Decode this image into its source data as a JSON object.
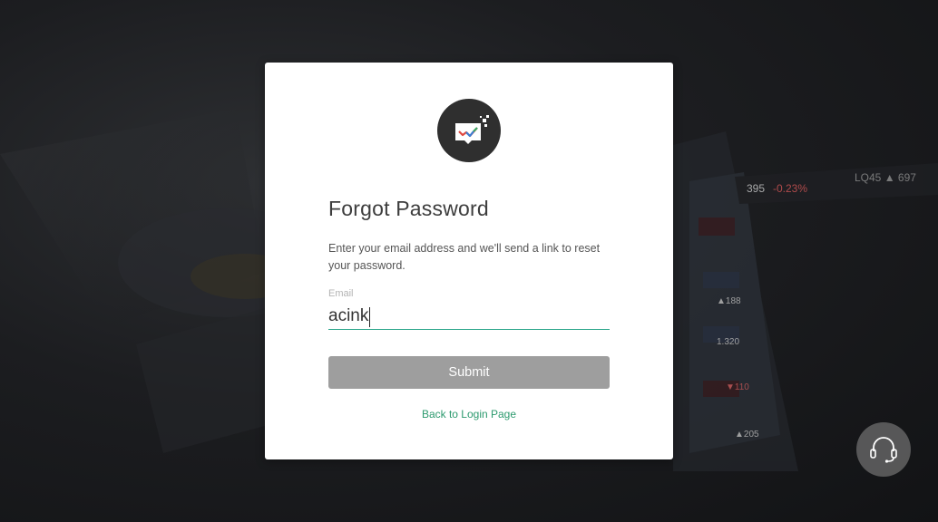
{
  "page": {
    "title": "Forgot Password",
    "description": "Enter your email address and we'll send a link to reset your password."
  },
  "form": {
    "email_label": "Email",
    "email_value": "acink",
    "submit_label": "Submit",
    "back_link_label": "Back to Login Page"
  },
  "icons": {
    "logo": "chat-bubble-checkmark-icon",
    "support": "headset-icon"
  },
  "colors": {
    "accent_green": "#2aa58a",
    "link_green": "#2c9a6e",
    "submit_disabled": "#9e9e9e",
    "logo_bg": "#2f2f2f"
  }
}
